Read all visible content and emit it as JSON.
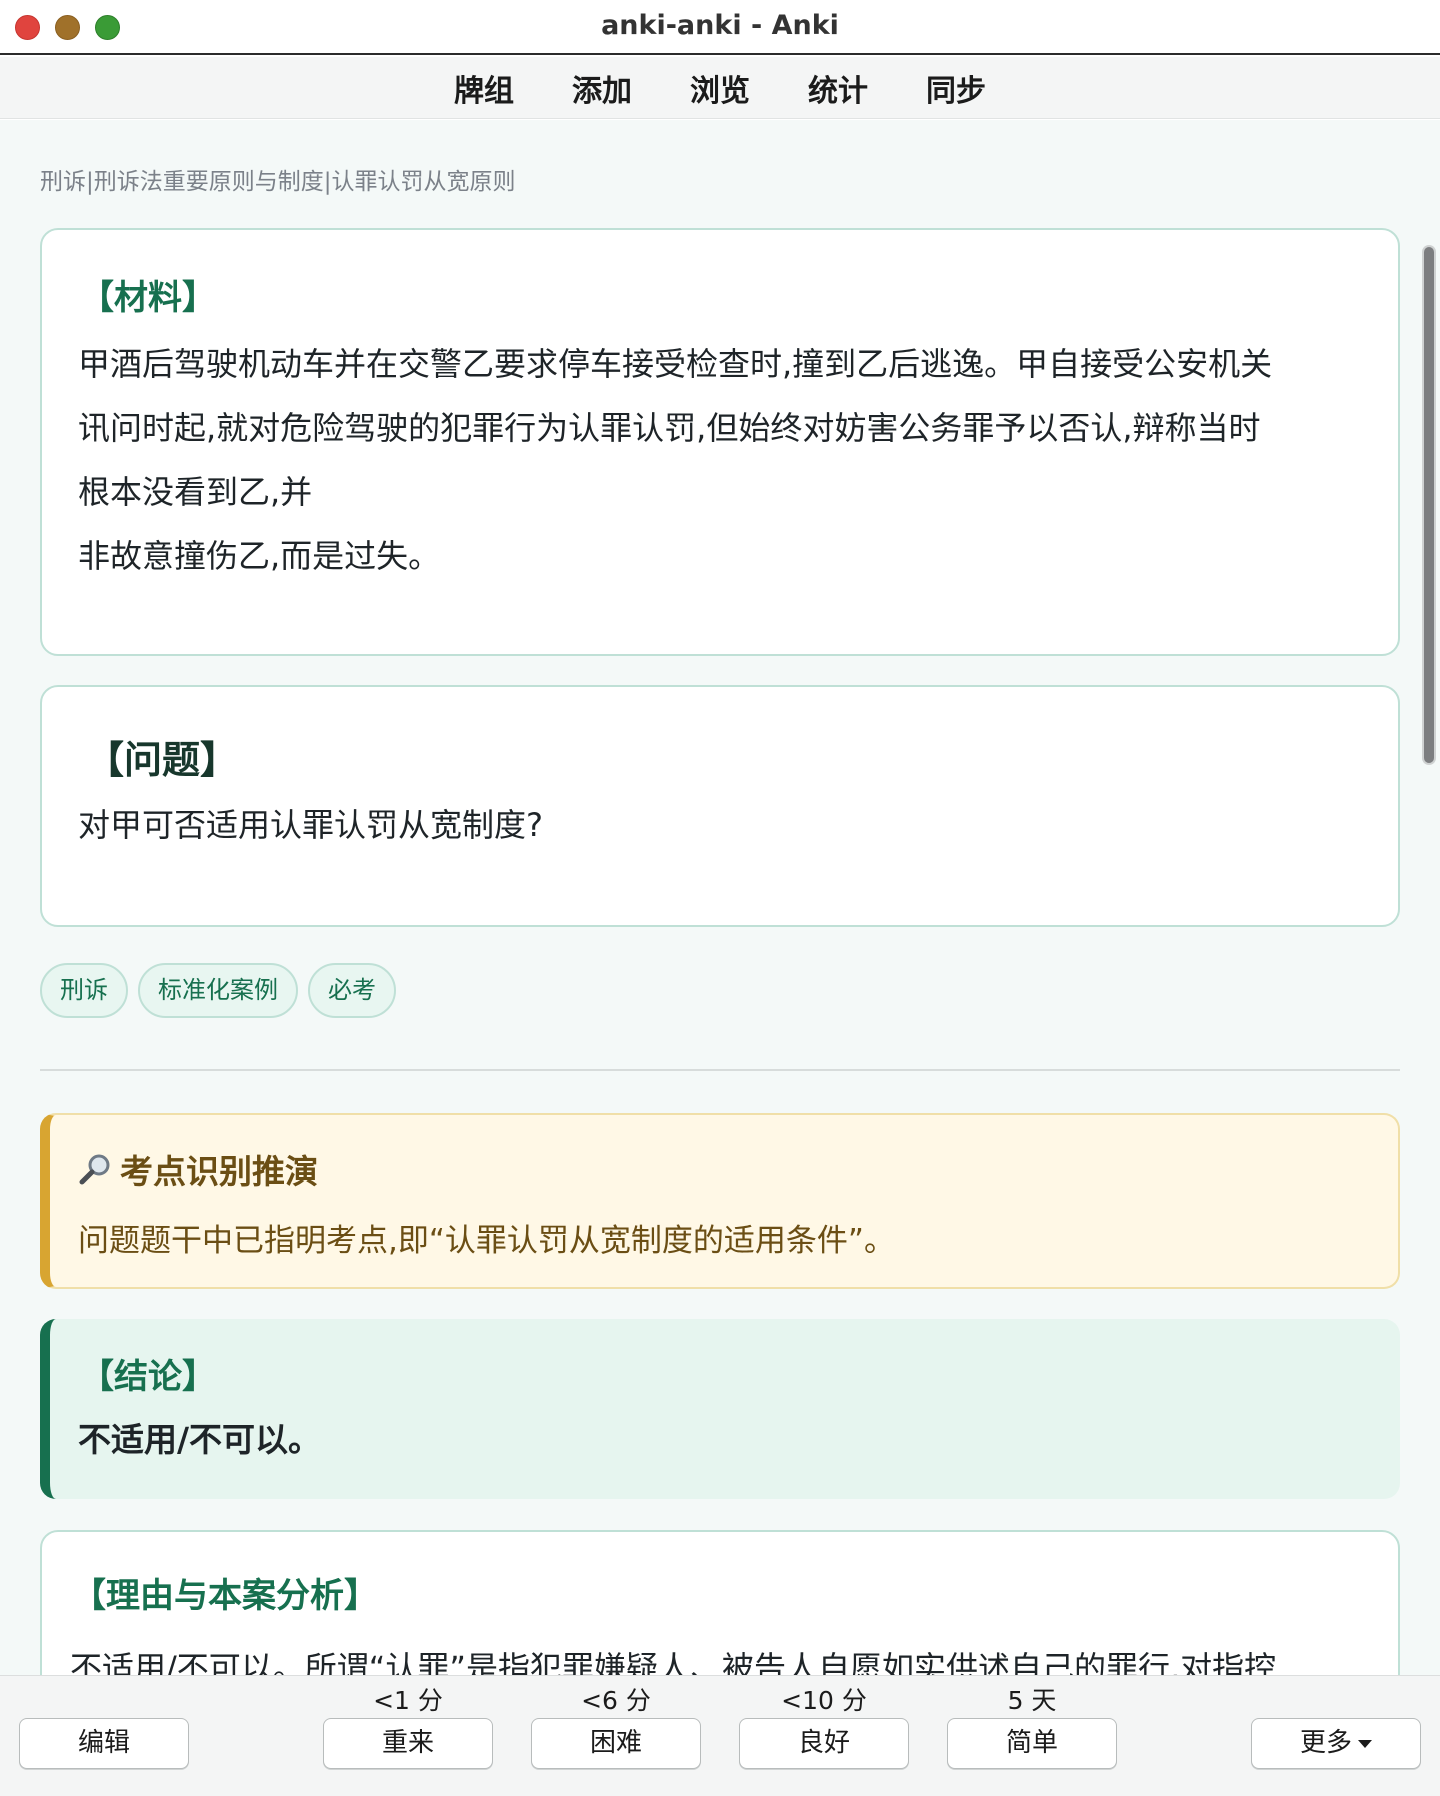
{
  "window": {
    "title": "anki-anki - Anki"
  },
  "toolbar": {
    "items": [
      "牌组",
      "添加",
      "浏览",
      "统计",
      "同步"
    ]
  },
  "card": {
    "breadcrumb": "刑诉|刑诉法重要原则与制度|认罪认罚从宽原则",
    "material": {
      "title": "【材料】",
      "lines": [
        "甲酒后驾驶机动车并在交警乙要求停车接受检查时,撞到乙后逃逸。甲自接受公安机关",
        "讯问时起,就对危险驾驶的犯罪行为认罪认罚,但始终对妨害公务罪予以否认,辩称当时",
        "根本没看到乙,并",
        "非故意撞伤乙,而是过失。"
      ]
    },
    "question": {
      "title": "【问题】",
      "text": "对甲可否适用认罪认罚从宽制度?"
    },
    "tags": [
      "刑诉",
      "标准化案例",
      "必考"
    ],
    "kaodian": {
      "title": "考点识别推演",
      "icon": "magnifier-icon",
      "text": "问题题干中已指明考点,即“认罪认罚从宽制度的适用条件”。"
    },
    "conclusion": {
      "title": "【结论】",
      "text": "不适用/不可以。"
    },
    "reason": {
      "title": "【理由与本案分析】",
      "text_partial": "不适用/不可以。所谓“认罪”是指犯罪嫌疑人、被告人自愿如实供述自己的罪行,对指控"
    }
  },
  "bottom": {
    "edit": "编辑",
    "more": "更多",
    "answers": [
      {
        "label": "重来",
        "interval": "<1 分"
      },
      {
        "label": "困难",
        "interval": "<6 分"
      },
      {
        "label": "良好",
        "interval": "<10 分"
      },
      {
        "label": "简单",
        "interval": "5 天"
      }
    ]
  },
  "colors": {
    "accent_green": "#17704f",
    "callout_yellow": "#d8a531",
    "background": "#f4f9f8"
  }
}
